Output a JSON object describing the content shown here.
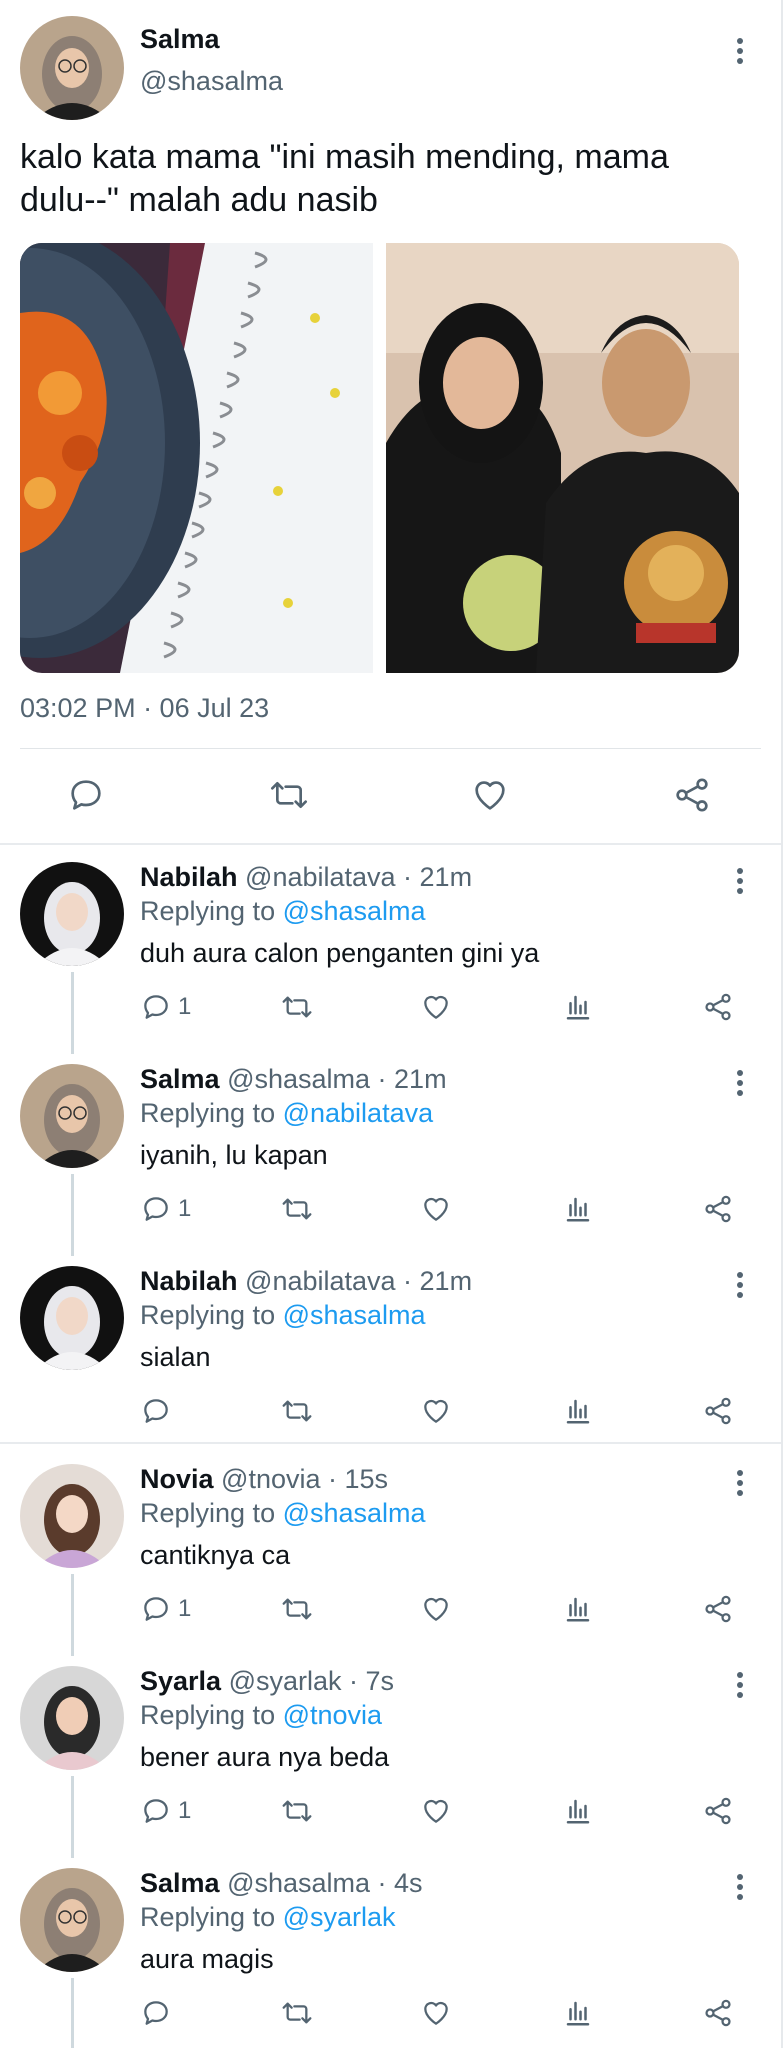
{
  "main_tweet": {
    "name": "Salma",
    "handle": "@shasalma",
    "text": "kalo kata mama \"ini masih mending, mama dulu--\" malah adu nasib",
    "timestamp": "03:02 PM · 06 Jul 23"
  },
  "replies": [
    {
      "name": "Nabilah",
      "meta": "@nabilatava · 21m",
      "replying_prefix": "Replying to ",
      "replying_to": "@shasalma",
      "text": "duh aura calon penganten gini ya",
      "reply_count": "1"
    },
    {
      "name": "Salma",
      "meta": "@shasalma · 21m",
      "replying_prefix": "Replying to ",
      "replying_to": "@nabilatava",
      "text": "iyanih, lu kapan",
      "reply_count": "1"
    },
    {
      "name": "Nabilah",
      "meta": "@nabilatava · 21m",
      "replying_prefix": "Replying to ",
      "replying_to": "@shasalma",
      "text": "sialan",
      "reply_count": ""
    },
    {
      "name": "Novia",
      "meta": "@tnovia · 15s",
      "replying_prefix": "Replying to ",
      "replying_to": "@shasalma",
      "text": "cantiknya ca",
      "reply_count": "1"
    },
    {
      "name": "Syarla",
      "meta": "@syarlak · 7s",
      "replying_prefix": "Replying to ",
      "replying_to": "@tnovia",
      "text": "bener aura nya beda",
      "reply_count": "1"
    },
    {
      "name": "Salma",
      "meta": "@shasalma · 4s",
      "replying_prefix": "Replying to ",
      "replying_to": "@syarlak",
      "text": "aura magis",
      "reply_count": ""
    }
  ],
  "icons": {
    "reply": "speech-bubble-icon",
    "retweet": "retweet-icon",
    "like": "heart-icon",
    "views": "bar-chart-icon",
    "share": "share-icon",
    "more": "more-vertical-icon"
  },
  "colors": {
    "text": "#0f1419",
    "secondary": "#536471",
    "link": "#1d9bf0",
    "divider": "#e1e5e8"
  }
}
